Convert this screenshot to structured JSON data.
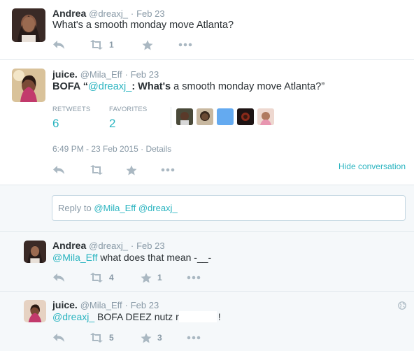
{
  "tweet1": {
    "name": "Andrea",
    "handle": "@dreaxj_",
    "sep": "·",
    "time": "Feb 23",
    "text": "What's a smooth monday move Atlanta?",
    "retweets": "1"
  },
  "main": {
    "name": "juice.",
    "handle": "@Mila_Eff",
    "sep": "·",
    "time": "Feb 23",
    "text_prefix": "BOFA “",
    "text_mention": "@dreaxj_",
    "text_colon": ": ",
    "text_bold": "What's",
    "text_rest": " a smooth monday move Atlanta?”",
    "retweets_label": "RETWEETS",
    "retweets_value": "6",
    "favorites_label": "FAVORITES",
    "favorites_value": "2",
    "timestamp": "6:49 PM - 23 Feb 2015",
    "details_sep": "·",
    "details_label": "Details",
    "hide_conversation": "Hide conversation"
  },
  "reply_box": {
    "prefix": "Reply to ",
    "mention1": "@Mila_Eff",
    "mention2": " @dreaxj_"
  },
  "reply1": {
    "name": "Andrea",
    "handle": "@dreaxj_",
    "sep": "·",
    "time": "Feb 23",
    "mention": "@Mila_Eff",
    "text": " what does that mean -__-",
    "retweets": "4",
    "favorites": "1"
  },
  "reply2": {
    "name": "juice.",
    "handle": "@Mila_Eff",
    "sep": "·",
    "time": "Feb 23",
    "mention": "@dreaxj_",
    "text_before": "  BOFA DEEZ nutz r",
    "text_after": "!",
    "retweets": "5",
    "favorites": "3"
  },
  "colors": {
    "link": "#2ab4c0",
    "muted": "#8899a6",
    "icon": "#aab8c2",
    "border": "#e1e8ed",
    "reply_bg": "#f5f8fa"
  },
  "icons": [
    "reply-icon",
    "retweet-icon",
    "favorite-icon",
    "more-icon",
    "globe-icon"
  ]
}
